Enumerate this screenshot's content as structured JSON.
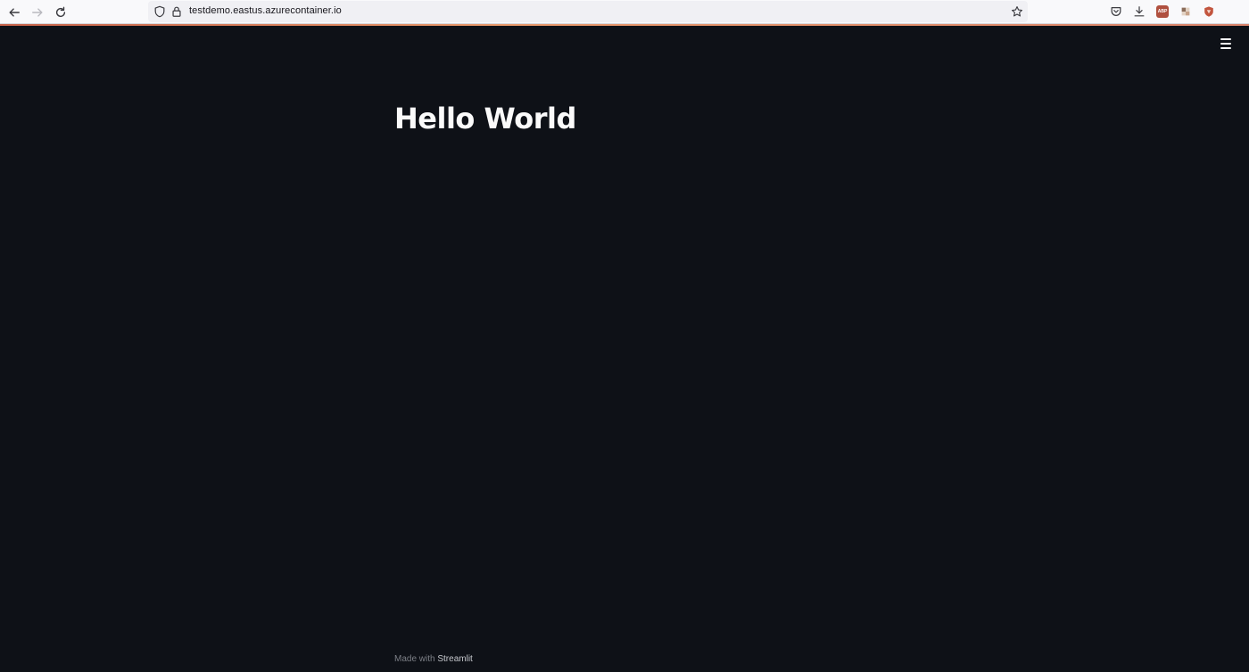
{
  "browser": {
    "url": "testdemo.eastus.azurecontainer.io",
    "icons": {
      "back": "back-arrow-icon",
      "forward": "forward-arrow-icon",
      "reload": "reload-icon",
      "shield": "tracking-shield-icon",
      "lock": "lock-icon",
      "bookmark": "star-icon",
      "pocket": "pocket-icon",
      "downloads": "download-icon",
      "adblock": "abp-icon",
      "extension": "extension-icon",
      "brave": "lion-shield-icon"
    },
    "adblock_label": "ABP",
    "progress_color": "#d9836a"
  },
  "app": {
    "title": "Hello World",
    "menu_icon": "hamburger-menu-icon",
    "background": "#0e1117",
    "footer": {
      "prefix": "Made with ",
      "link": "Streamlit"
    }
  }
}
